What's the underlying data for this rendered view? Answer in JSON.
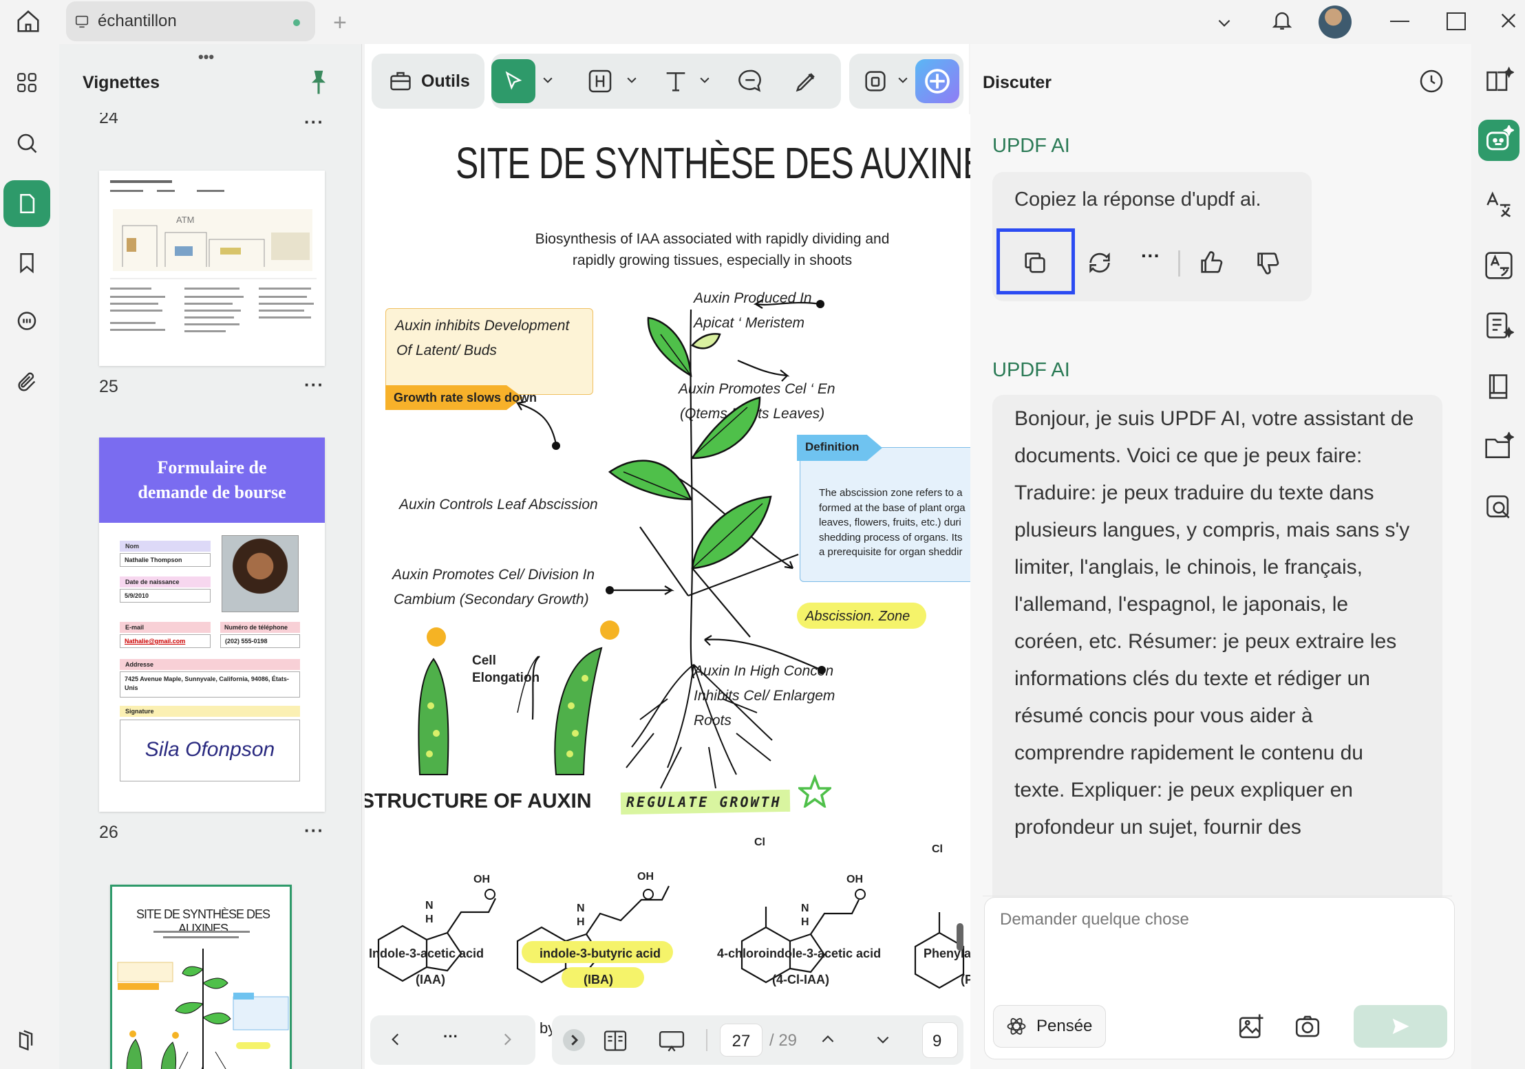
{
  "titlebar": {
    "tab_title": "échantillon"
  },
  "thumbnails": {
    "title": "Vignettes",
    "pages": [
      {
        "number": "24"
      },
      {
        "number": "25"
      },
      {
        "number": "26"
      }
    ],
    "page25": {
      "title_line1": "Formulaire de",
      "title_line2": "demande de bourse",
      "fields": {
        "nom_label": "Nom",
        "nom_value": "Nathalie Thompson",
        "date_label": "Date de naissance",
        "date_value": "5/9/2010",
        "email_label": "E-mail",
        "email_value": "Nathalie@gmail.com",
        "phone_label": "Numéro de téléphone",
        "phone_value": "(202) 555-0198",
        "address_label": "Addresse",
        "address_value": "7425 Avenue Maple, Sunnyvale, California, 94086, États-Unis",
        "signature_label": "Signature",
        "signature_value": "Sila Ofonpson"
      }
    },
    "page26_title": "SITE DE SYNTHÈSE DES AUXINES"
  },
  "toolbar": {
    "tools_label": "Outils"
  },
  "document": {
    "title": "SITE DE SYNTHÈSE DES AUXINES",
    "subtitle_line1": "Biosynthesis of IAA associated with rapidly dividing and",
    "subtitle_line2": "rapidly growing tissues, especially in shoots",
    "inhibits_line1": "Auxin inhibits Development",
    "inhibits_line2": "Of Latent/ Buds",
    "growth_rate": "Growth rate slows down",
    "produced_line1": "Auxin Produced In",
    "produced_line2": "Apicat ‘ Meristem",
    "promotes_line1": "Auxin Promotes Cel ‘ En",
    "promotes_line2": "(Qtems Roots Leaves)",
    "definition_label": "Definition",
    "definition_lines": [
      "The abscission zone refers to a",
      "formed at the base of plant orga",
      "leaves, flowers, fruits, etc.) duri",
      "shedding process of organs. Its",
      "a prerequisite for organ sheddir"
    ],
    "leaf_abscission": "Auxin Controls Leaf Abscission",
    "cambium_line1": "Auxin Promotes Cel/ Division In",
    "cambium_line2": "Cambium (Secondary Growth)",
    "abscission_zone": "Abscission. Zone",
    "cell_line1": "Cell",
    "cell_line2": "Elongation",
    "high_line1": "Auxin In High Concen",
    "high_line2": "Inhibits Cel/ Enlargem",
    "high_line3": "Roots",
    "structure_title": "STRUCTURE OF AUXIN",
    "regulate": "REGULATE GROWTH",
    "molecules": [
      {
        "name": "Indole-3-acetic acid",
        "abbr": "(IAA)"
      },
      {
        "name": "indole-3-butyric acid",
        "abbr": "(IBA)"
      },
      {
        "name": "4-chloroindole-3-acetic acid",
        "abbr": "(4-Cl-IAA)"
      },
      {
        "name": "Phenyla",
        "abbr": "(P"
      }
    ],
    "atom_oh": "OH",
    "atom_n": "N",
    "atom_h": "H",
    "atom_cl": "Cl"
  },
  "pagination": {
    "current": "27",
    "total": "/ 29",
    "partial_left": "by",
    "partial_right": "9"
  },
  "chat": {
    "title": "Discuter",
    "sender1": "UPDF AI",
    "message1": "Copiez la réponse d'updf ai.",
    "sender2": "UPDF AI",
    "message2_lines": [
      "Bonjour, je suis UPDF AI, votre assistant de",
      "documents. Voici ce que je peux faire:",
      "Traduire: je peux traduire du texte dans",
      "plusieurs langues, y compris, mais sans s'y",
      "limiter, l'anglais, le chinois, le français,",
      "l'allemand, l'espagnol, le japonais, le",
      "coréen, etc. Résumer: je peux extraire les",
      "informations clés du texte et rédiger un",
      "résumé concis pour vous aider à",
      "comprendre rapidement le contenu du",
      "texte. Expliquer: je peux expliquer en",
      "profondeur un sujet, fournir des"
    ],
    "input_placeholder": "Demander quelque chose",
    "thinking_label": "Pensée"
  },
  "colors": {
    "accent": "#2e9a6a",
    "highlight_box": "#2b4bf2",
    "form_header": "#7a6cf0"
  }
}
